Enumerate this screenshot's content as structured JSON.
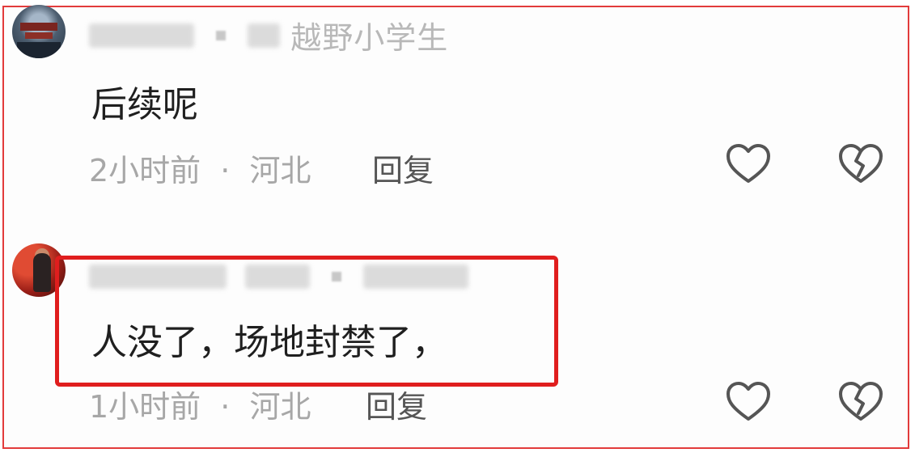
{
  "comments": [
    {
      "username_suffix": "越野小学生",
      "text": "后续呢",
      "time": "2小时前",
      "separator": "·",
      "location": "河北",
      "reply_label": "回复"
    },
    {
      "username_suffix": "",
      "text": "人没了，场地封禁了，",
      "time": "1小时前",
      "separator": "·",
      "location": "河北",
      "reply_label": "回复"
    }
  ],
  "icons": {
    "like": "heart-outline-icon",
    "dislike": "broken-heart-icon"
  },
  "colors": {
    "highlight": "#e01e1e",
    "frame": "#e23b3b",
    "meta_text": "#a7a7a7",
    "body_text": "#1f1f1f"
  }
}
